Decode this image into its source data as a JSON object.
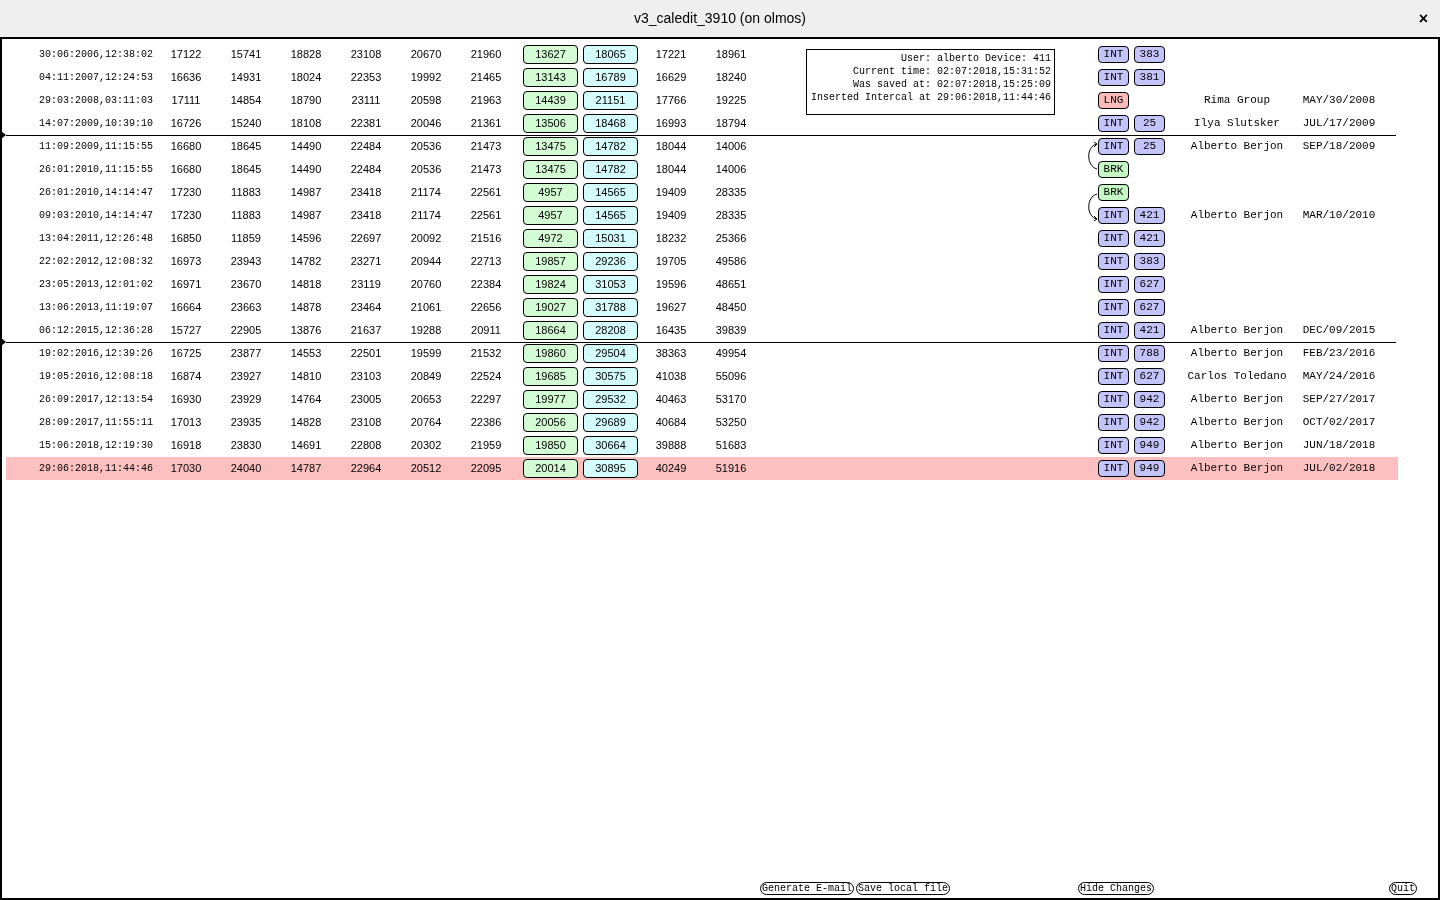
{
  "window": {
    "title": "v3_caledit_3910 (on olmos)",
    "close": "×"
  },
  "info": [
    "User: alberto Device: 411",
    "Current time: 02:07:2018,15:31:52",
    "Was saved at: 02:07:2018,15:25:09",
    "Inserted Intercal at 29:06:2018,11:44:46"
  ],
  "rows": [
    {
      "time": "30:06:2006,12:38:02",
      "values": [
        "17122",
        "15741",
        "18828",
        "23108",
        "20670",
        "21960"
      ],
      "green": "13627",
      "cyan": "18065",
      "extra": [
        "17221",
        "18961"
      ],
      "tag": "INT",
      "code": "383",
      "selected": false,
      "break_above": false
    },
    {
      "time": "04:11:2007,12:24:53",
      "values": [
        "16636",
        "14931",
        "18024",
        "22353",
        "19992",
        "21465"
      ],
      "green": "13143",
      "cyan": "16789",
      "extra": [
        "16629",
        "18240"
      ],
      "tag": "INT",
      "code": "381",
      "selected": false,
      "break_above": false
    },
    {
      "time": "29:03:2008,03:11:03",
      "values": [
        "17111",
        "14854",
        "18790",
        "23111",
        "20598",
        "21963"
      ],
      "green": "14439",
      "cyan": "21151",
      "extra": [
        "17766",
        "19225"
      ],
      "tag": "LNG",
      "name": "Rima Group",
      "date": "MAY/30/2008",
      "selected": false,
      "break_above": false
    },
    {
      "time": "14:07:2009,10:39:10",
      "values": [
        "16726",
        "15240",
        "18108",
        "22381",
        "20046",
        "21361"
      ],
      "green": "13506",
      "cyan": "18468",
      "extra": [
        "16993",
        "18794"
      ],
      "tag": "INT",
      "code": "25",
      "name": "Ilya Slutsker",
      "date": "JUL/17/2009",
      "selected": false,
      "break_above": false
    },
    {
      "time": "11:09:2009,11:15:55",
      "values": [
        "16680",
        "18645",
        "14490",
        "22484",
        "20536",
        "21473"
      ],
      "green": "13475",
      "cyan": "14782",
      "extra": [
        "18044",
        "14006"
      ],
      "tag": "INT",
      "code": "25",
      "name": "Alberto Berjon",
      "date": "SEP/18/2009",
      "selected": false,
      "break_above": true,
      "link_below": true
    },
    {
      "time": "26:01:2010,11:15:55",
      "values": [
        "16680",
        "18645",
        "14490",
        "22484",
        "20536",
        "21473"
      ],
      "green": "13475",
      "cyan": "14782",
      "extra": [
        "18044",
        "14006"
      ],
      "tag": "BRK",
      "selected": false,
      "break_above": false
    },
    {
      "time": "26:01:2010,14:14:47",
      "values": [
        "17230",
        "11883",
        "14987",
        "23418",
        "21174",
        "22561"
      ],
      "green": "4957",
      "cyan": "14565",
      "extra": [
        "19409",
        "28335"
      ],
      "tag": "BRK",
      "selected": false,
      "break_above": false
    },
    {
      "time": "09:03:2010,14:14:47",
      "values": [
        "17230",
        "11883",
        "14987",
        "23418",
        "21174",
        "22561"
      ],
      "green": "4957",
      "cyan": "14565",
      "extra": [
        "19409",
        "28335"
      ],
      "tag": "INT",
      "code": "421",
      "name": "Alberto Berjon",
      "date": "MAR/10/2010",
      "selected": false,
      "break_above": false,
      "link_above": true
    },
    {
      "time": "13:04:2011,12:26:48",
      "values": [
        "16850",
        "11859",
        "14596",
        "22697",
        "20092",
        "21516"
      ],
      "green": "4972",
      "cyan": "15031",
      "extra": [
        "18232",
        "25366"
      ],
      "tag": "INT",
      "code": "421",
      "selected": false,
      "break_above": false
    },
    {
      "time": "22:02:2012,12:08:32",
      "values": [
        "16973",
        "23943",
        "14782",
        "23271",
        "20944",
        "22713"
      ],
      "green": "19857",
      "cyan": "29236",
      "extra": [
        "19705",
        "49586"
      ],
      "tag": "INT",
      "code": "383",
      "selected": false,
      "break_above": false
    },
    {
      "time": "23:05:2013,12:01:02",
      "values": [
        "16971",
        "23670",
        "14818",
        "23119",
        "20760",
        "22384"
      ],
      "green": "19824",
      "cyan": "31053",
      "extra": [
        "19596",
        "48651"
      ],
      "tag": "INT",
      "code": "627",
      "selected": false,
      "break_above": false
    },
    {
      "time": "13:06:2013,11:19:07",
      "values": [
        "16664",
        "23663",
        "14878",
        "23464",
        "21061",
        "22656"
      ],
      "green": "19027",
      "cyan": "31788",
      "extra": [
        "19627",
        "48450"
      ],
      "tag": "INT",
      "code": "627",
      "selected": false,
      "break_above": false
    },
    {
      "time": "06:12:2015,12:36:28",
      "values": [
        "15727",
        "22905",
        "13876",
        "21637",
        "19288",
        "20911"
      ],
      "green": "18664",
      "cyan": "28208",
      "extra": [
        "16435",
        "39839"
      ],
      "tag": "INT",
      "code": "421",
      "name": "Alberto Berjon",
      "date": "DEC/09/2015",
      "selected": false,
      "break_above": false
    },
    {
      "time": "19:02:2016,12:39:26",
      "values": [
        "16725",
        "23877",
        "14553",
        "22501",
        "19599",
        "21532"
      ],
      "green": "19860",
      "cyan": "29504",
      "extra": [
        "38363",
        "49954"
      ],
      "tag": "INT",
      "code": "788",
      "name": "Alberto Berjon",
      "date": "FEB/23/2016",
      "selected": false,
      "break_above": true
    },
    {
      "time": "19:05:2016,12:08:18",
      "values": [
        "16874",
        "23927",
        "14810",
        "23103",
        "20849",
        "22524"
      ],
      "green": "19685",
      "cyan": "30575",
      "extra": [
        "41038",
        "55096"
      ],
      "tag": "INT",
      "code": "627",
      "name": "Carlos Toledano",
      "date": "MAY/24/2016",
      "selected": false,
      "break_above": false
    },
    {
      "time": "26:09:2017,12:13:54",
      "values": [
        "16930",
        "23929",
        "14764",
        "23005",
        "20653",
        "22297"
      ],
      "green": "19977",
      "cyan": "29532",
      "extra": [
        "40463",
        "53170"
      ],
      "tag": "INT",
      "code": "942",
      "name": "Alberto Berjon",
      "date": "SEP/27/2017",
      "selected": false,
      "break_above": false
    },
    {
      "time": "28:09:2017,11:55:11",
      "values": [
        "17013",
        "23935",
        "14828",
        "23108",
        "20764",
        "22386"
      ],
      "green": "20056",
      "cyan": "29689",
      "extra": [
        "40684",
        "53250"
      ],
      "tag": "INT",
      "code": "942",
      "name": "Alberto Berjon",
      "date": "OCT/02/2017",
      "selected": false,
      "break_above": false
    },
    {
      "time": "15:06:2018,12:19:30",
      "values": [
        "16918",
        "23830",
        "14691",
        "22808",
        "20302",
        "21959"
      ],
      "green": "19850",
      "cyan": "30664",
      "extra": [
        "39888",
        "51683"
      ],
      "tag": "INT",
      "code": "949",
      "name": "Alberto Berjon",
      "date": "JUN/18/2018",
      "selected": false,
      "break_above": false
    },
    {
      "time": "29:06:2018,11:44:46",
      "values": [
        "17030",
        "24040",
        "14787",
        "22964",
        "20512",
        "22095"
      ],
      "green": "20014",
      "cyan": "30895",
      "extra": [
        "40249",
        "51916"
      ],
      "tag": "INT",
      "code": "949",
      "name": "Alberto Berjon",
      "date": "JUL/02/2018",
      "selected": true,
      "break_above": false
    }
  ],
  "buttons": [
    {
      "label": "Generate E-mail"
    },
    {
      "label": "Save local file"
    },
    {
      "label": "Hide Changes"
    },
    {
      "label": "Quit"
    }
  ]
}
